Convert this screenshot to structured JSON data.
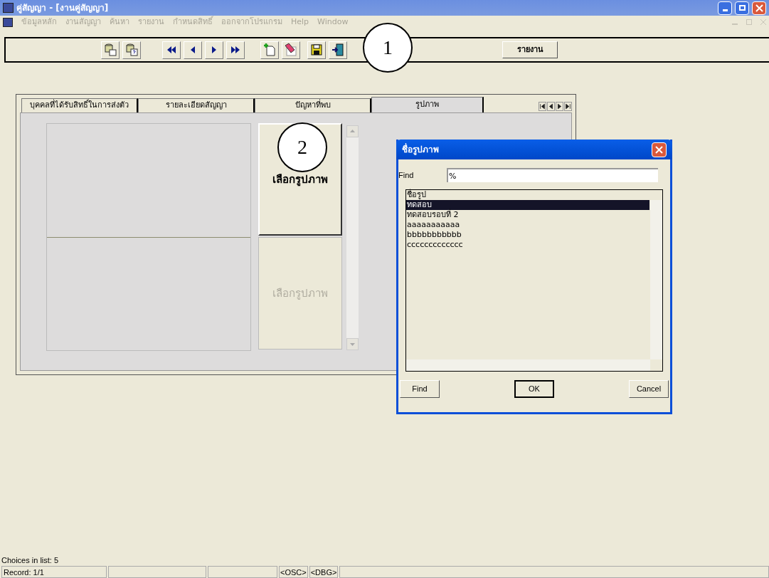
{
  "window": {
    "title": "คู่สัญญา - [งานคู่สัญญา]"
  },
  "menu": [
    "ข้อมูลหลัก",
    "งานสัญญา",
    "ค้นหา",
    "รายงาน",
    "กำหนดสิทธิ์",
    "ออกจากโปรแกรม",
    "Help",
    "Window"
  ],
  "toolbar": {
    "report_button": "รายงาน"
  },
  "tabs": [
    {
      "label": "บุคคลที่ได้รับสิทธิ์ในการส่งตัว",
      "selected": false
    },
    {
      "label": "รายละเอียดสัญญา",
      "selected": false
    },
    {
      "label": "ปัญหาที่พบ",
      "selected": false
    },
    {
      "label": "รูปภาพ",
      "selected": true
    }
  ],
  "picture_buttons": [
    {
      "label": "เลือกรูปภาพ",
      "disabled": false
    },
    {
      "label": "เลือกรูปภาพ",
      "disabled": true
    }
  ],
  "annotations": [
    "1",
    "2"
  ],
  "dialog": {
    "title": "ชื่อรูปภาพ",
    "find_label": "Find",
    "find_value": "%",
    "list_header": "ชื่อรูป",
    "items": [
      {
        "label": "ทดสอบ",
        "selected": true
      },
      {
        "label": "ทดสอบรอบที่ 2",
        "selected": false
      },
      {
        "label": "aaaaaaaaaaa",
        "selected": false
      },
      {
        "label": "bbbbbbbbbbb",
        "selected": false
      },
      {
        "label": "ccccccccccccc",
        "selected": false
      }
    ],
    "buttons": [
      "Find",
      "OK",
      "Cancel"
    ]
  },
  "status": {
    "message": "Choices in list: 5",
    "record": "Record: 1/1",
    "osc": "<OSC>",
    "dbg": "<DBG>"
  }
}
